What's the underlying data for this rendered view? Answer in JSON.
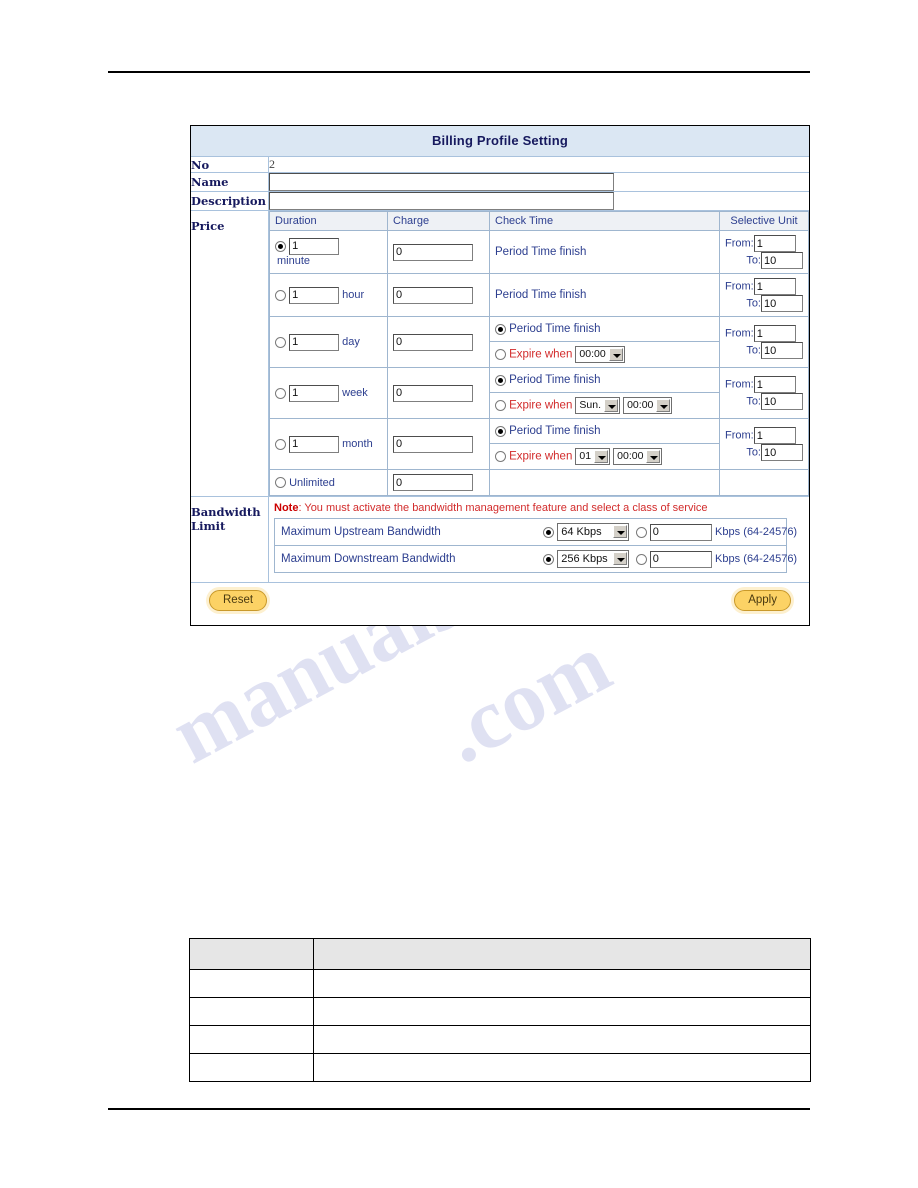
{
  "page": {
    "watermark_line1": "manualshive",
    "watermark_line2": ".com"
  },
  "form": {
    "title": "Billing Profile Setting",
    "rows": {
      "no_label": "No",
      "no_value": "2",
      "name_label": "Name",
      "name_value": "",
      "name_placeholder": "",
      "description_label": "Description",
      "description_value": "",
      "description_placeholder": "",
      "price_label": "Price",
      "bandwidth_label": "Bandwidth Limit"
    },
    "price_table": {
      "headers": {
        "duration": "Duration",
        "charge": "Charge",
        "check_time": "Check Time",
        "selective_unit": "Selective Unit"
      },
      "from_label": "From:",
      "to_label": "To:",
      "period_label": "Period Time finish",
      "expire_label": "Expire when",
      "rows": [
        {
          "id": "minute",
          "selected": true,
          "qty": "1",
          "unit": "minute",
          "unit_wrap": true,
          "charge": "0",
          "check": [
            {
              "type": "plain",
              "label": "Period Time finish"
            }
          ],
          "from": "1",
          "to": "10"
        },
        {
          "id": "hour",
          "selected": false,
          "qty": "1",
          "unit": "hour",
          "unit_wrap": false,
          "charge": "0",
          "check": [
            {
              "type": "plain",
              "label": "Period Time finish"
            }
          ],
          "from": "1",
          "to": "10"
        },
        {
          "id": "day",
          "selected": false,
          "qty": "1",
          "unit": "day",
          "unit_wrap": false,
          "charge": "0",
          "check": [
            {
              "type": "radio",
              "selected": true,
              "label": "Period Time finish"
            },
            {
              "type": "expire",
              "selected": false,
              "label": "Expire when",
              "selects": [
                "00:00"
              ]
            }
          ],
          "from": "1",
          "to": "10"
        },
        {
          "id": "week",
          "selected": false,
          "qty": "1",
          "unit": "week",
          "unit_wrap": false,
          "charge": "0",
          "check": [
            {
              "type": "radio",
              "selected": true,
              "label": "Period Time finish"
            },
            {
              "type": "expire",
              "selected": false,
              "label": "Expire when",
              "selects": [
                "Sun.",
                "00:00"
              ]
            }
          ],
          "from": "1",
          "to": "10"
        },
        {
          "id": "month",
          "selected": false,
          "qty": "1",
          "unit": "month",
          "unit_wrap": false,
          "charge": "0",
          "check": [
            {
              "type": "radio",
              "selected": true,
              "label": "Period Time finish"
            },
            {
              "type": "expire",
              "selected": false,
              "label": "Expire when",
              "selects": [
                "01",
                "00:00"
              ]
            }
          ],
          "from": "1",
          "to": "10"
        },
        {
          "id": "unlimited",
          "selected": false,
          "unlimited_label": "Unlimited",
          "charge": "0",
          "check": [],
          "from": null,
          "to": null
        }
      ]
    },
    "bandwidth": {
      "note_prefix": "Note",
      "note_text": ": You must activate the bandwidth management feature and select a class of service",
      "rows": [
        {
          "label": "Maximum Upstream Bandwidth",
          "preset_selected": true,
          "preset_value": "64 Kbps",
          "custom_selected": false,
          "custom_value": "0",
          "unit": "Kbps",
          "range": "(64-24576)"
        },
        {
          "label": "Maximum Downstream Bandwidth",
          "preset_selected": true,
          "preset_value": "256 Kbps",
          "custom_selected": false,
          "custom_value": "0",
          "unit": "Kbps",
          "range": "(64-24576)"
        }
      ]
    },
    "buttons": {
      "reset": "Reset",
      "apply": "Apply"
    }
  },
  "description_table": {
    "header": [
      "",
      ""
    ],
    "rows": [
      [
        "",
        ""
      ],
      [
        "",
        ""
      ],
      [
        "",
        ""
      ],
      [
        "",
        ""
      ]
    ]
  },
  "colors": {
    "title_bg": "#dbe7f3",
    "label_text": "#16195e",
    "table_text": "#2c3e8f",
    "alert_text": "#d22b2b",
    "button_bg": "#fcd265",
    "grid_line": "#9fb6cf"
  }
}
